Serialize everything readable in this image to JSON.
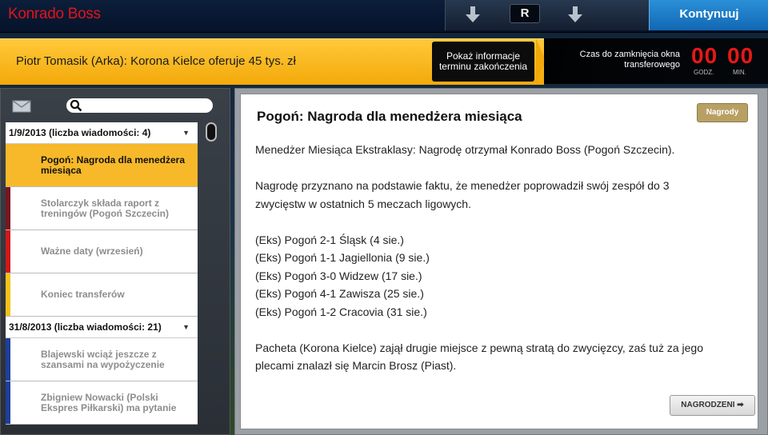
{
  "header": {
    "manager_name": "Konrado Boss",
    "nav_r_label": "R",
    "continue_label": "Kontynuuj"
  },
  "news_strip": {
    "text": "Piotr Tomasik (Arka): Korona Kielce oferuje 45 tys. zł",
    "info_button": "Pokaż informacje terminu zakończenia"
  },
  "transfer_timer": {
    "label": "Czas do zamknięcia okna transferowego",
    "hours": "00",
    "hours_unit": "GODZ.",
    "minutes": "00",
    "minutes_unit": "MIN."
  },
  "inbox": {
    "search_placeholder": "",
    "groups": [
      {
        "header": "1/9/2013 (liczba wiadomości: 4)",
        "items": [
          {
            "label": "Pogoń: Nagroda dla menedżera miesiąca",
            "color": "#f7b92a"
          },
          {
            "label": "Stolarczyk składa raport z treningów (Pogoń Szczecin)",
            "color": "#7a1420"
          },
          {
            "label": "Ważne daty (wrzesień)",
            "color": "#d01818"
          },
          {
            "label": "Koniec transferów",
            "color": "#f2c21a"
          }
        ]
      },
      {
        "header": "31/8/2013 (liczba wiadomości: 21)",
        "items": [
          {
            "label": "Blajewski wciąż jeszcze z szansami na wypożyczenie",
            "color": "#1e3f9a"
          },
          {
            "label": "Zbigniew Nowacki (Polski Ekspres Piłkarski) ma pytanie",
            "color": "#1e3f9a"
          }
        ]
      }
    ]
  },
  "message": {
    "title": "Pogoń: Nagroda dla menedżera miesiąca",
    "badge": "Nagrody",
    "para1": "Menedżer Miesiąca Ekstraklasy: Nagrodę otrzymał Konrado Boss (Pogoń Szczecin).",
    "para2a": "Nagrodę przyznano na podstawie faktu, że menedżer poprowadził swój zespół do 3",
    "para2b": "zwycięstw w ostatnich 5 meczach ligowych.",
    "results": [
      "(Eks) Pogoń 2-1 Śląsk (4 sie.)",
      "(Eks) Pogoń 1-1 Jagiellonia (9 sie.)",
      "(Eks) Pogoń 3-0 Widzew (17 sie.)",
      "(Eks) Pogoń 4-1 Zawisza (25 sie.)",
      "(Eks) Pogoń 1-2 Cracovia (31 sie.)"
    ],
    "para3a": "Pacheta (Korona Kielce) zajął drugie miejsce z pewną stratą do zwycięzcy, zaś tuż za jego",
    "para3b": "plecami znalazł się Marcin Brosz (Piast).",
    "winners_button": "NAGRODZENI ➡"
  }
}
